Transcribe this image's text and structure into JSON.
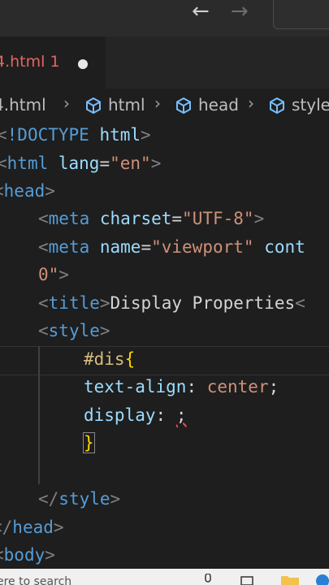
{
  "titlebar": {
    "back_icon": "arrow-left-icon",
    "forward_icon": "arrow-right-icon"
  },
  "tab": {
    "label": "4.html 1"
  },
  "breadcrumb": {
    "items": [
      "4.html",
      "html",
      "head",
      "style"
    ]
  },
  "code": {
    "l1": [
      "<",
      "!DOCTYPE",
      " html",
      ">"
    ],
    "l2": [
      "<",
      "html",
      " lang",
      "=",
      "\"en\"",
      ">"
    ],
    "l3": [
      "<",
      "head",
      ">"
    ],
    "l4": [
      "<",
      "meta",
      " charset",
      "=",
      "\"UTF-8\"",
      ">"
    ],
    "l5": [
      "<",
      "meta",
      " name",
      "=",
      "\"viewport\"",
      " cont"
    ],
    "l6": [
      "0\"",
      ">"
    ],
    "l7": [
      "<",
      "title",
      ">",
      "Display Properties",
      "<"
    ],
    "l8": [
      "<",
      "style",
      ">"
    ],
    "l9": [
      "#dis",
      "{"
    ],
    "l10": [
      "text-align",
      ": ",
      "center",
      ";"
    ],
    "l11": [
      "display",
      ": ",
      ";"
    ],
    "l12": [
      "}"
    ],
    "l14": [
      "</",
      "style",
      ">"
    ],
    "l15": [
      "</",
      "head",
      ">"
    ],
    "l16": [
      "<",
      "body",
      ">"
    ]
  },
  "taskbar": {
    "search_placeholder": "ere to search"
  }
}
